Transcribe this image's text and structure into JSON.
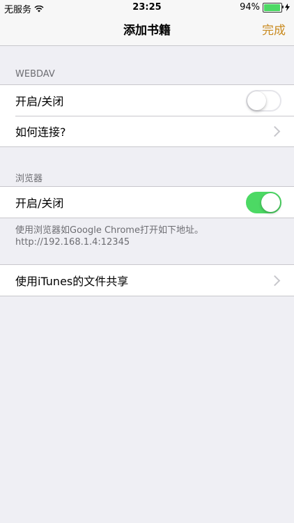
{
  "status_bar": {
    "carrier": "无服务",
    "time": "23:25",
    "battery_percent": "94%",
    "battery_level": 0.94
  },
  "nav": {
    "title": "添加书籍",
    "done_label": "完成",
    "accent_color": "#c98a1f"
  },
  "webdav": {
    "header": "WEBDAV",
    "toggle_label": "开启/关闭",
    "toggle_on": false,
    "howto_label": "如何连接?"
  },
  "browser": {
    "header": "浏览器",
    "toggle_label": "开启/关闭",
    "toggle_on": true,
    "note_line1": "使用浏览器如Google Chrome打开如下地址。",
    "note_line2": "http://192.168.1.4:12345"
  },
  "itunes": {
    "label": "使用iTunes的文件共享"
  },
  "colors": {
    "toggle_on": "#4cd964",
    "background": "#efeff4"
  }
}
